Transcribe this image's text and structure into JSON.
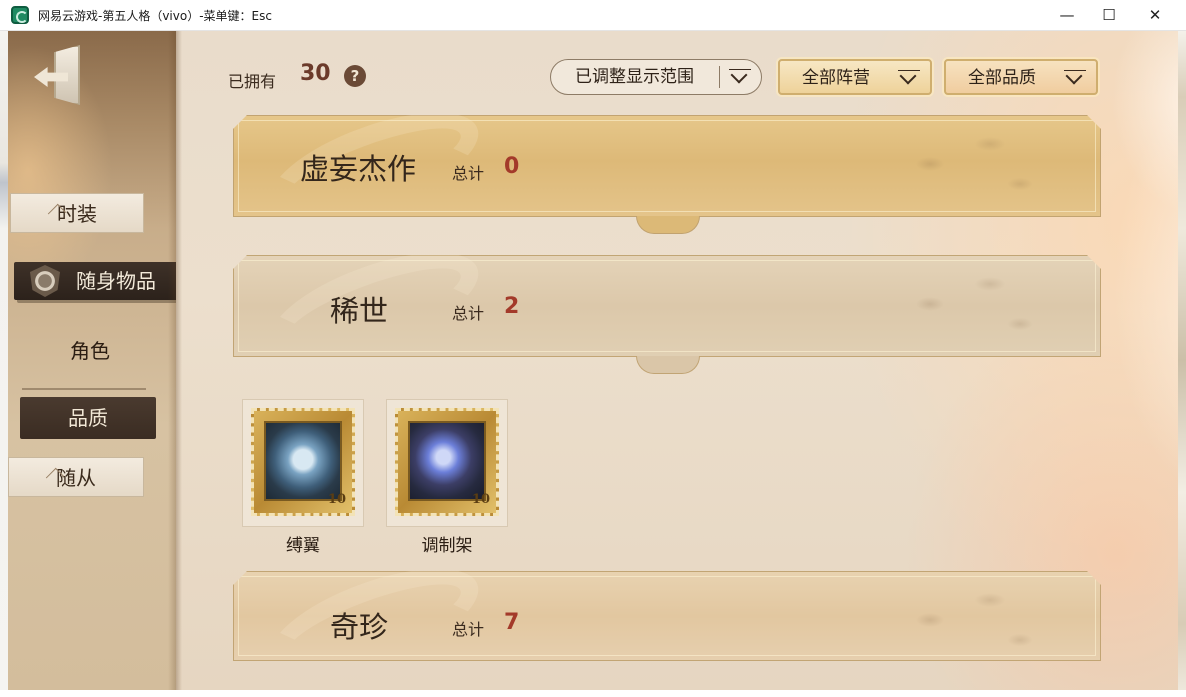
{
  "window": {
    "title": "网易云游戏-第五人格（vivo）-菜单键：Esc",
    "minimize": "—",
    "maximize": "☐",
    "close": "✕"
  },
  "sidebar": {
    "tabs": [
      {
        "label": "时装"
      },
      {
        "label": "随身物品"
      },
      {
        "label": "角色"
      },
      {
        "label": "品质"
      },
      {
        "label": "随从"
      }
    ]
  },
  "header": {
    "owned_label": "已拥有",
    "owned_count": "30",
    "help": "?",
    "filters": {
      "range": "已调整显示范围",
      "faction": "全部阵营",
      "quality": "全部品质"
    }
  },
  "categories": [
    {
      "title": "虚妄杰作",
      "total_label": "总计",
      "total": "0"
    },
    {
      "title": "稀世",
      "total_label": "总计",
      "total": "2"
    },
    {
      "title": "奇珍",
      "total_label": "总计",
      "total": "7"
    }
  ],
  "items": [
    {
      "name": "缚翼",
      "mark": "10"
    },
    {
      "name": "调制架",
      "mark": "10"
    }
  ],
  "colors": {
    "accent_gold": "#ddb978",
    "count_red": "#a33a2a",
    "active_tab_dark": "#3e3128"
  }
}
